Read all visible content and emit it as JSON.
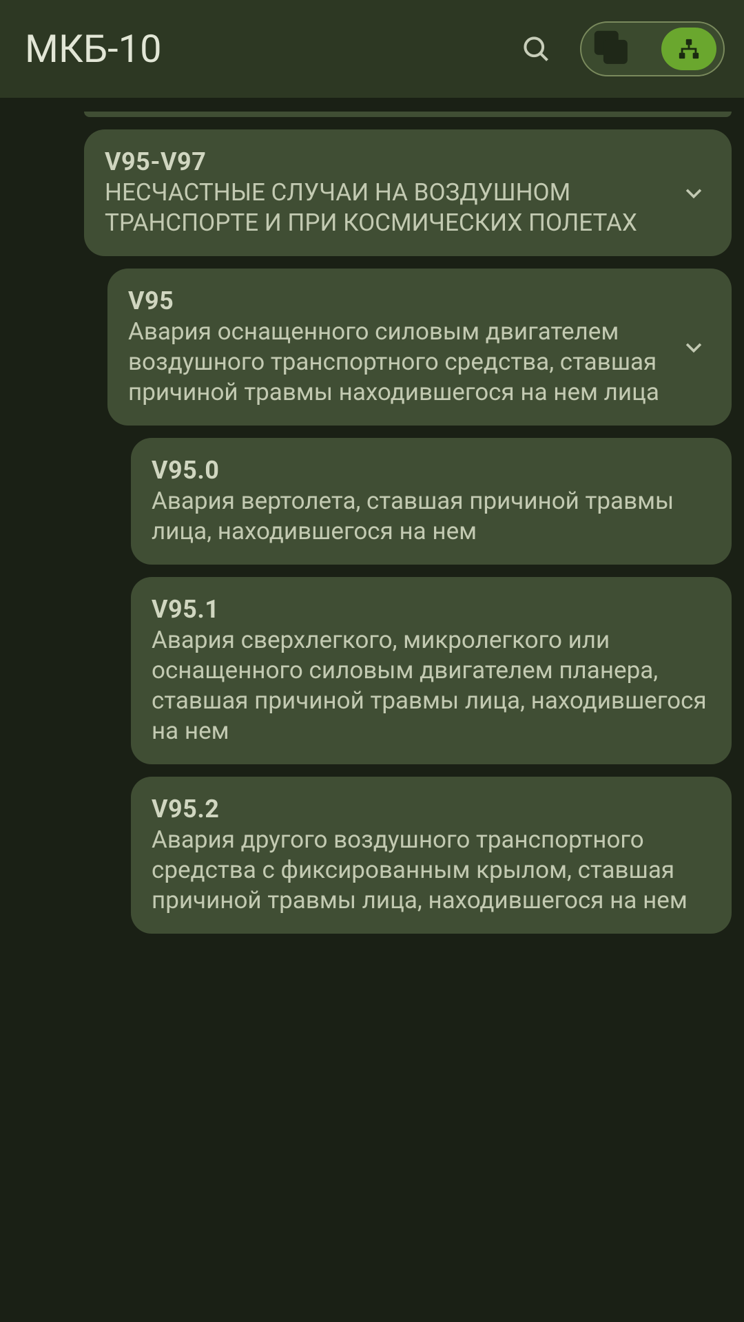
{
  "header": {
    "title": "МКБ-10"
  },
  "icons": {
    "search": "search-icon",
    "copy": "copy-stack-icon",
    "tree": "hierarchy-icon",
    "chevron": "chevron-down-icon"
  },
  "items": [
    {
      "code": "V95-V97",
      "desc": "НЕСЧАСТНЫЕ СЛУЧАИ НА ВОЗДУШНОМ ТРАНСПОРТЕ И ПРИ КОСМИЧЕСКИХ ПОЛЕТАХ",
      "level": 0,
      "expandable": true
    },
    {
      "code": "V95",
      "desc": "Авария оснащенного силовым двигателем воздушного транспортного средства, ставшая причиной травмы находившегося на нем лица",
      "level": 1,
      "expandable": true
    },
    {
      "code": "V95.0",
      "desc": "Авария вертолета, ставшая причиной травмы лица, находившегося на нем",
      "level": 2,
      "expandable": false
    },
    {
      "code": "V95.1",
      "desc": "Авария сверхлегкого, микролегкого или оснащенного силовым двигателем планера, ставшая причиной травмы лица, находившегося на нем",
      "level": 2,
      "expandable": false
    },
    {
      "code": "V95.2",
      "desc": "Авария другого воздушного транспортного средства с фиксированным крылом, ставшая причиной травмы лица, находившегося на нем",
      "level": 2,
      "expandable": false
    }
  ]
}
